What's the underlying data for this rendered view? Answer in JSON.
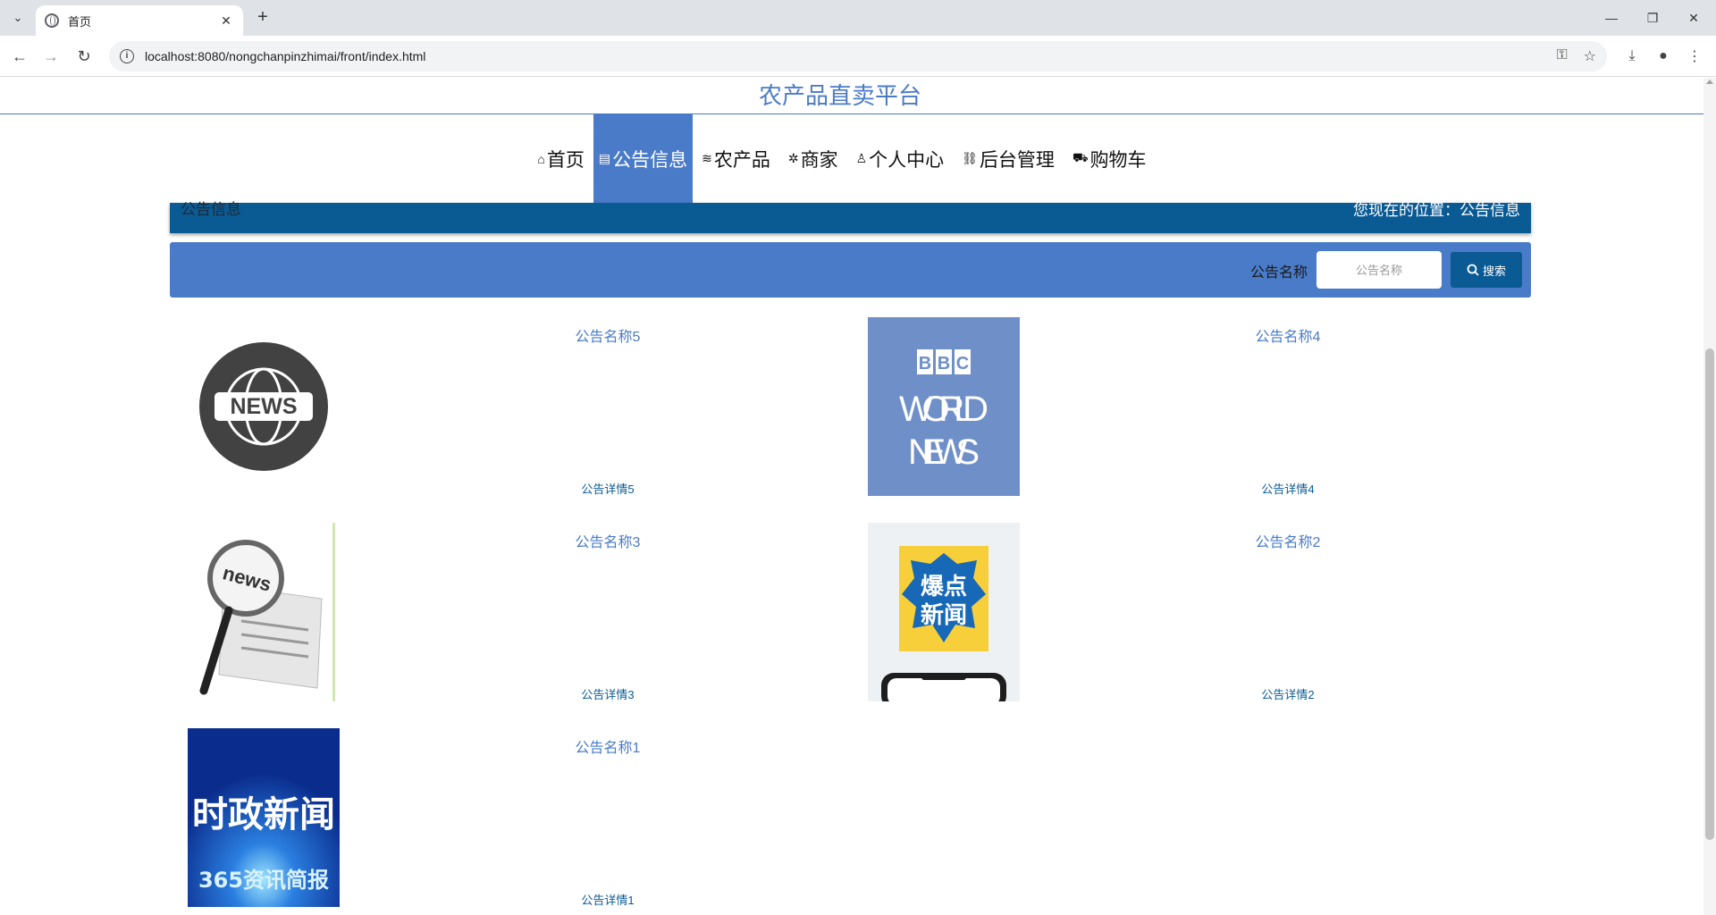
{
  "browser": {
    "tab_title": "首页",
    "url": "localhost:8080/nongchanpinzhimai/front/index.html"
  },
  "site": {
    "title": "农产品直卖平台"
  },
  "nav": {
    "items": [
      {
        "icon": "⌂",
        "label": "首页"
      },
      {
        "icon": "▤",
        "label": "公告信息"
      },
      {
        "icon": "≋",
        "label": "农产品"
      },
      {
        "icon": "✲",
        "label": "商家"
      },
      {
        "icon": "♙",
        "label": "个人中心"
      },
      {
        "icon": "⛓",
        "label": "后台管理"
      },
      {
        "icon": "⛟",
        "label": "购物车"
      }
    ],
    "active": "公告信息"
  },
  "breadcrumb": {
    "section": "公告信息",
    "prefix": "您现在的位置：",
    "current": "公告信息"
  },
  "search": {
    "label": "公告名称",
    "placeholder": "公告名称",
    "button": "搜索"
  },
  "news": [
    {
      "name": "公告名称5",
      "detail": "公告详情5",
      "thumb_text": "NEWS"
    },
    {
      "name": "公告名称4",
      "detail": "公告详情4",
      "thumb_text": "BBC WORLD NEWS"
    },
    {
      "name": "公告名称3",
      "detail": "公告详情3",
      "thumb_text": "news"
    },
    {
      "name": "公告名称2",
      "detail": "公告详情2",
      "thumb_text": "爆点新闻"
    },
    {
      "name": "公告名称1",
      "detail": "公告详情1",
      "thumb_text": "时政新闻 365资讯简报"
    }
  ],
  "colors": {
    "primary": "#4a7bc8",
    "dark": "#0a5a94"
  }
}
